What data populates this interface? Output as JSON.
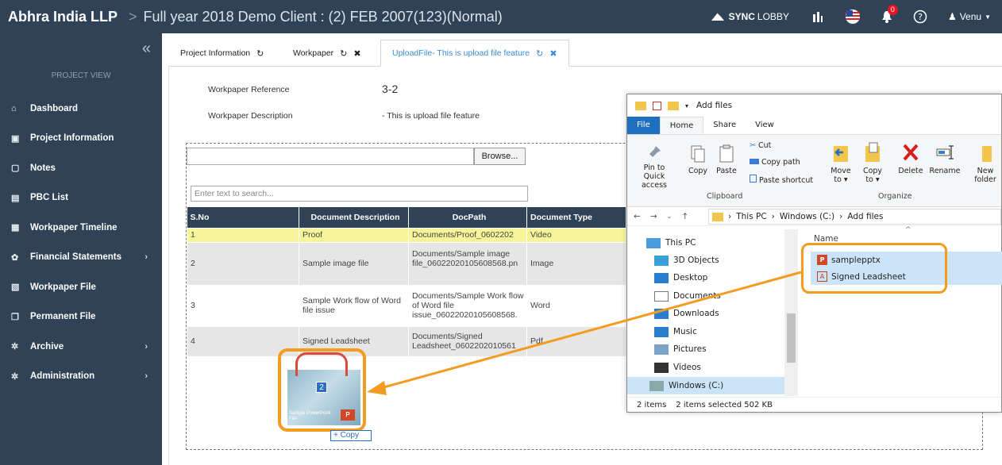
{
  "header": {
    "brand": "Abhra India LLP",
    "separator": ">",
    "project": "Full year 2018 Demo Client : (2) FEB 2007(123)(Normal)",
    "sync": {
      "bold": "SYNC",
      "rest": "LOBBY"
    },
    "notification_count": "0",
    "user": "Venu"
  },
  "sidebar": {
    "collapse": "«",
    "section": "PROJECT VIEW",
    "items": [
      {
        "icon": "home-icon",
        "glyph": "⌂",
        "label": "Dashboard",
        "arrow": ""
      },
      {
        "icon": "info-icon",
        "glyph": "▣",
        "label": "Project Information",
        "arrow": ""
      },
      {
        "icon": "notes-icon",
        "glyph": "▢",
        "label": "Notes",
        "arrow": ""
      },
      {
        "icon": "list-icon",
        "glyph": "▤",
        "label": "PBC List",
        "arrow": ""
      },
      {
        "icon": "calendar-icon",
        "glyph": "▦",
        "label": "Workpaper Timeline",
        "arrow": ""
      },
      {
        "icon": "cogs-icon",
        "glyph": "✿",
        "label": "Financial Statements",
        "arrow": "›"
      },
      {
        "icon": "file-icon",
        "glyph": "▧",
        "label": "Workpaper File",
        "arrow": ""
      },
      {
        "icon": "copy-icon",
        "glyph": "❐",
        "label": "Permanent File",
        "arrow": ""
      },
      {
        "icon": "gear-icon",
        "glyph": "✲",
        "label": "Archive",
        "arrow": "›"
      },
      {
        "icon": "gear-icon",
        "glyph": "✲",
        "label": "Administration",
        "arrow": "›"
      }
    ]
  },
  "tabs": [
    {
      "label": "Project Information",
      "refresh": "↻",
      "close": ""
    },
    {
      "label": "Workpaper",
      "refresh": "↻",
      "close": "✖"
    },
    {
      "label": "UploadFile- This is upload file feature",
      "refresh": "↻",
      "close": "✖"
    }
  ],
  "workpaper": {
    "ref_label": "Workpaper Reference",
    "ref_value": "3-2",
    "desc_label": "Workpaper Description",
    "desc_value": "- This is upload file feature"
  },
  "upload": {
    "browse": "Browse...",
    "search_placeholder": "Enter text to search...",
    "columns": [
      "S.No",
      "Document Description",
      "DocPath",
      "Document Type"
    ],
    "rows": [
      {
        "sno": "1",
        "desc": "Proof",
        "path": "Documents/Proof_0602202",
        "type": "Video"
      },
      {
        "sno": "2",
        "desc": "Sample image file",
        "path": "Documents/Sample image file_06022020105608568.pn",
        "type": "Image"
      },
      {
        "sno": "3",
        "desc": "Sample Work flow of Word file issue",
        "path": "Documents/Sample Work flow of Word file issue_06022020105608568.",
        "type": "Word"
      },
      {
        "sno": "4",
        "desc": "Signed Leadsheet",
        "path": "Documents/Signed Leadsheet_0602202010561",
        "type": "Pdf"
      }
    ]
  },
  "drag": {
    "count": "2",
    "caption": "Sample PowerPoint File",
    "copy": "+ Copy"
  },
  "explorer": {
    "title": "Add files",
    "ribbon_tabs": [
      "File",
      "Home",
      "Share",
      "View"
    ],
    "buttons": {
      "pin": "Pin to Quick access",
      "copy": "Copy",
      "paste": "Paste",
      "cut": "Cut",
      "copy_path": "Copy path",
      "paste_shortcut": "Paste shortcut",
      "move_to": "Move to ▾",
      "copy_to": "Copy to ▾",
      "delete": "Delete",
      "rename": "Rename",
      "new_folder": "New folder"
    },
    "groups": {
      "clipboard": "Clipboard",
      "organize": "Organize"
    },
    "path": [
      "This PC",
      "Windows (C:)",
      "Add files"
    ],
    "tree": [
      "This PC",
      "3D Objects",
      "Desktop",
      "Documents",
      "Downloads",
      "Music",
      "Pictures",
      "Videos",
      "Windows (C:)"
    ],
    "column": "Name",
    "files": [
      "samplepptx",
      "Signed Leadsheet"
    ],
    "status": {
      "items": "2 items",
      "selected": "2 items selected  502 KB"
    }
  },
  "colors": {
    "sidebar": "#2f4256",
    "accent": "#f39c1f",
    "highlight_row": "#f7f599"
  }
}
